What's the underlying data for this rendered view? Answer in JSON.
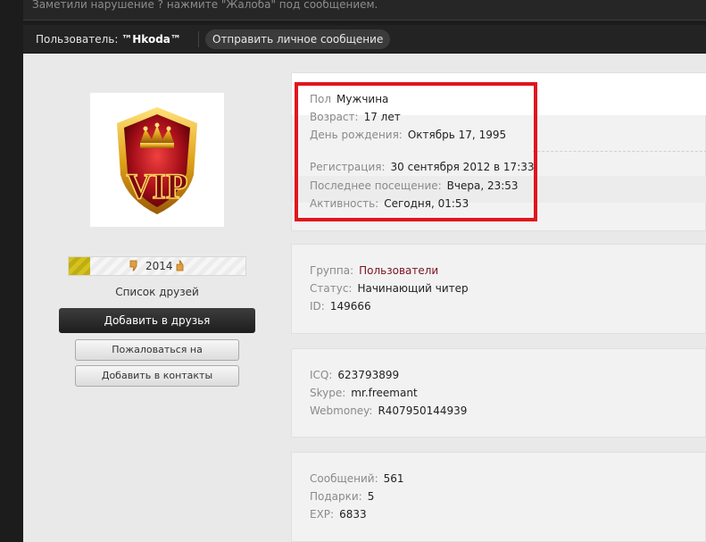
{
  "notice": "Заметили нарушение ? нажмите \"Жалоба\" под сообщением.",
  "userbar": {
    "user_label": "Пользователь:",
    "username": "™Hkoda™",
    "pm_button": "Отправить личное сообщение"
  },
  "profile": {
    "avatar_text": "VIP",
    "rating": {
      "value": "2014"
    },
    "friends_link": "Список друзей",
    "add_friend_button": "Добавить в друзья",
    "report_button": "Пожаловаться на пользователя",
    "add_contacts_button": "Добавить в контакты"
  },
  "personal": {
    "gender_label": "Пол",
    "gender": "Мужчина",
    "age_label": "Возраст:",
    "age": "17 лет",
    "birthday_label": "День рождения:",
    "birthday": "Октябрь 17, 1995",
    "registered_label": "Регистрация:",
    "registered": "30 сентября 2012 в 17:33",
    "last_visit_label": "Последнее посещение:",
    "last_visit": "Вчера, 23:53",
    "activity_label": "Активность:",
    "activity": "Сегодня, 01:53"
  },
  "account": {
    "group_label": "Группа:",
    "group": "Пользователи",
    "status_label": "Статус:",
    "status": "Начинающий читер",
    "id_label": "ID:",
    "id": "149666"
  },
  "contacts": {
    "icq_label": "ICQ:",
    "icq": "623793899",
    "skype_label": "Skype:",
    "skype": "mr.freemant",
    "webmoney_label": "Webmoney:",
    "webmoney": "R407950144939"
  },
  "stats": {
    "messages_label": "Сообщений:",
    "messages": "561",
    "gifts_label": "Подарки:",
    "gifts": "5",
    "exp_label": "EXP:",
    "exp": "6833"
  },
  "colors": {
    "highlight": "#e1141e",
    "link": "#7a1422",
    "rating_fill": "#d6c21e"
  }
}
